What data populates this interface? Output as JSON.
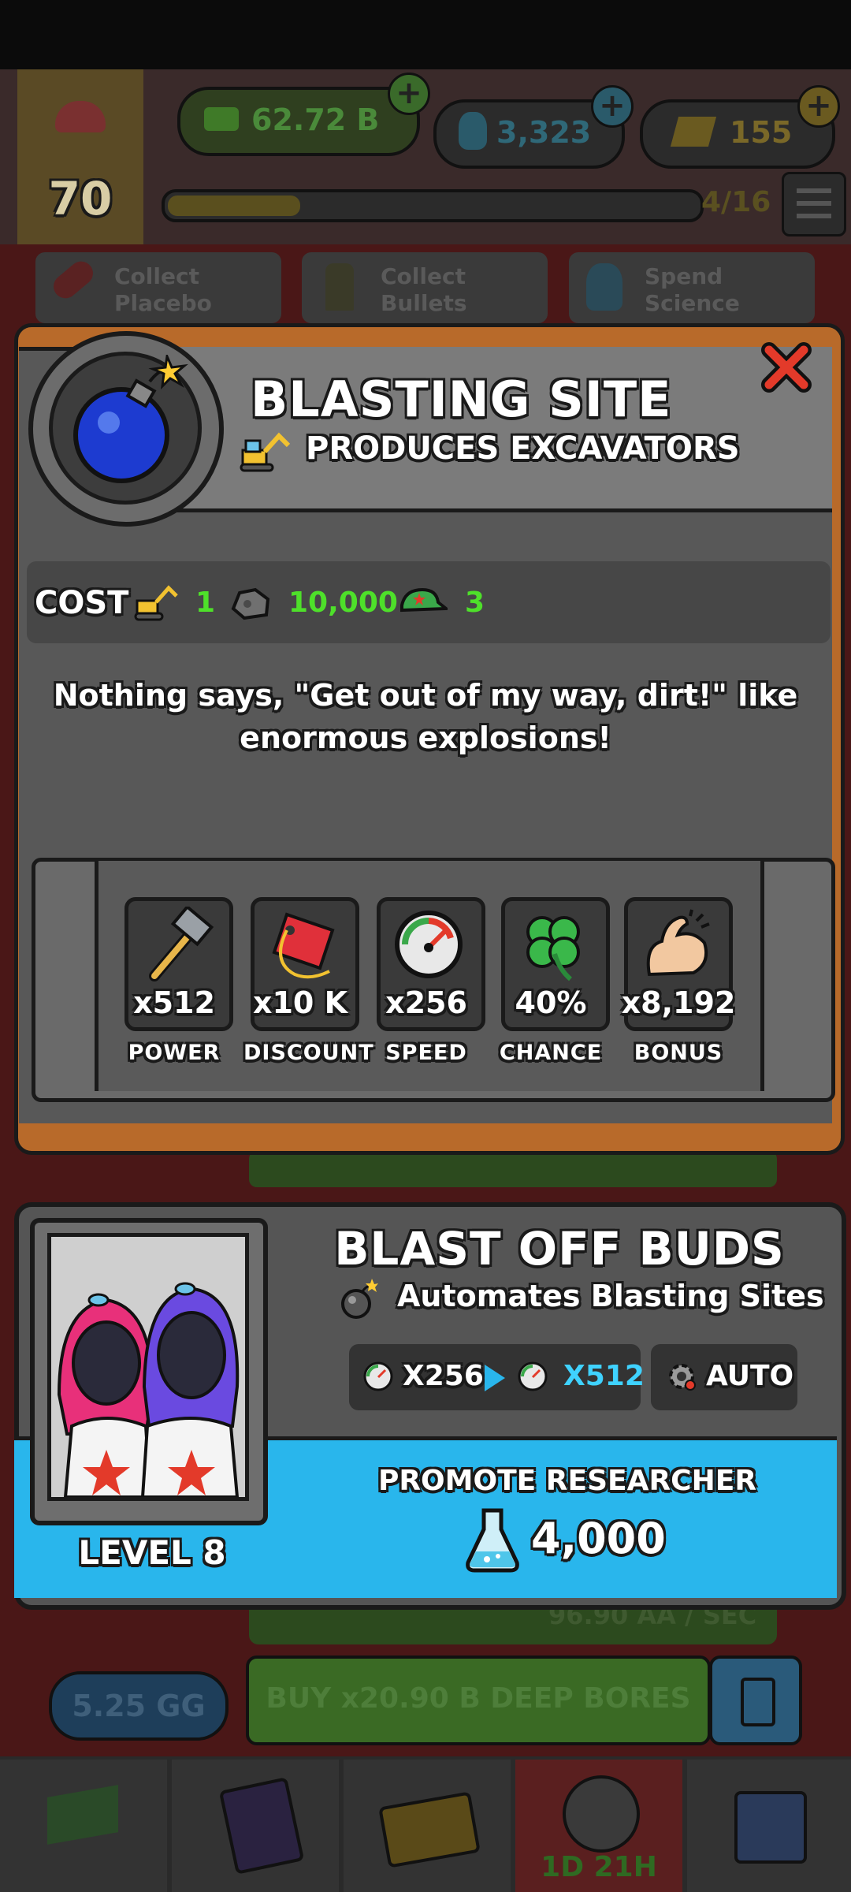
{
  "hud": {
    "level": "70",
    "cash": "62.72 B",
    "science": "3,323",
    "tickets": "155",
    "progress": "4/16",
    "progress_fraction": 0.25
  },
  "tasks": [
    {
      "line1": "Collect",
      "line2": "Placebo"
    },
    {
      "line1": "Collect",
      "line2": "Bullets"
    },
    {
      "line1": "Spend",
      "line2": "Science"
    }
  ],
  "modal": {
    "title": "BLASTING SITE",
    "subtitle": "PRODUCES EXCAVATORS",
    "cost_label": "COST",
    "costs": [
      {
        "icon": "excavator-icon",
        "amount": "1"
      },
      {
        "icon": "rock-icon",
        "amount": "10,000"
      },
      {
        "icon": "army-cap-icon",
        "amount": "3"
      }
    ],
    "description_line1": "Nothing says, \"Get out of my way, dirt!\" like",
    "description_line2": "enormous explosions!",
    "stats": [
      {
        "icon": "hammer-icon",
        "value": "x512",
        "label": "POWER"
      },
      {
        "icon": "price-tag-icon",
        "value": "x10 K",
        "label": "DISCOUNT"
      },
      {
        "icon": "speedometer-icon",
        "value": "x256",
        "label": "SPEED"
      },
      {
        "icon": "four-leaf-clover-icon",
        "value": "40%",
        "label": "CHANCE"
      },
      {
        "icon": "flexed-arm-icon",
        "value": "x8,192",
        "label": "BONUS"
      }
    ]
  },
  "researcher": {
    "name": "BLAST OFF BUDS",
    "automates": "Automates Blasting Sites",
    "speed_from": "X256",
    "speed_to": "X512",
    "auto_label": "AUTO",
    "level": "LEVEL 8",
    "promote_label": "PROMOTE RESEARCHER",
    "promote_cost": "4,000"
  },
  "background": {
    "rate": "96.90 AA / SEC",
    "amount": "5.25 GG",
    "buy_label": "BUY x20.90 B DEEP BORES",
    "timer": "1D 21H"
  },
  "colors": {
    "accent_green": "#4ee02a",
    "accent_cyan": "#3fd2ff",
    "promote_blue": "#29b6ec",
    "close_red": "#e33a2a"
  }
}
